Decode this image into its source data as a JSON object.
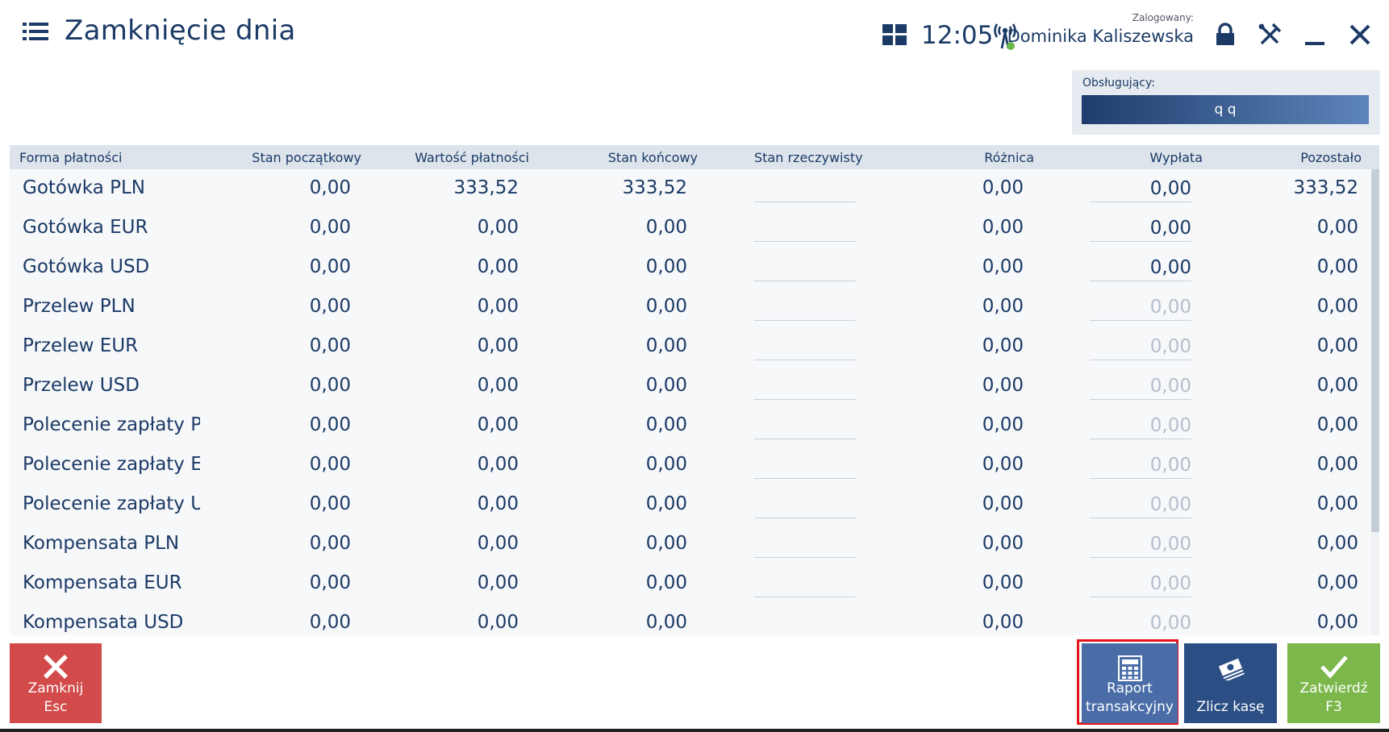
{
  "header": {
    "title": "Zamknięcie dnia",
    "time": "12:05",
    "logged_caption": "Zalogowany:",
    "user_name": "Dominika Kaliszewska",
    "icons": [
      "menu-icon",
      "tiles-icon",
      "antenna-icon",
      "lock-icon",
      "tools-icon",
      "minimize-icon",
      "close-icon"
    ]
  },
  "operator": {
    "label": "Obsługujący:",
    "value": "q q"
  },
  "table": {
    "columns": [
      "Forma płatności",
      "Stan początkowy",
      "Wartość płatności",
      "Stan końcowy",
      "Stan rzeczywisty",
      "Różnica",
      "Wypłata",
      "Pozostało"
    ],
    "rows": [
      {
        "name": "Gotówka PLN",
        "start": "0,00",
        "payment": "333,52",
        "end": "333,52",
        "diff": "0,00",
        "payout": "0,00",
        "payout_enabled": true,
        "left": "333,52"
      },
      {
        "name": "Gotówka EUR",
        "start": "0,00",
        "payment": "0,00",
        "end": "0,00",
        "diff": "0,00",
        "payout": "0,00",
        "payout_enabled": true,
        "left": "0,00"
      },
      {
        "name": "Gotówka USD",
        "start": "0,00",
        "payment": "0,00",
        "end": "0,00",
        "diff": "0,00",
        "payout": "0,00",
        "payout_enabled": true,
        "left": "0,00"
      },
      {
        "name": "Przelew PLN",
        "start": "0,00",
        "payment": "0,00",
        "end": "0,00",
        "diff": "0,00",
        "payout": "0,00",
        "payout_enabled": false,
        "left": "0,00"
      },
      {
        "name": "Przelew EUR",
        "start": "0,00",
        "payment": "0,00",
        "end": "0,00",
        "diff": "0,00",
        "payout": "0,00",
        "payout_enabled": false,
        "left": "0,00"
      },
      {
        "name": "Przelew USD",
        "start": "0,00",
        "payment": "0,00",
        "end": "0,00",
        "diff": "0,00",
        "payout": "0,00",
        "payout_enabled": false,
        "left": "0,00"
      },
      {
        "name": "Polecenie zapłaty PLN",
        "start": "0,00",
        "payment": "0,00",
        "end": "0,00",
        "diff": "0,00",
        "payout": "0,00",
        "payout_enabled": false,
        "left": "0,00"
      },
      {
        "name": "Polecenie zapłaty EUR",
        "start": "0,00",
        "payment": "0,00",
        "end": "0,00",
        "diff": "0,00",
        "payout": "0,00",
        "payout_enabled": false,
        "left": "0,00"
      },
      {
        "name": "Polecenie zapłaty USD",
        "start": "0,00",
        "payment": "0,00",
        "end": "0,00",
        "diff": "0,00",
        "payout": "0,00",
        "payout_enabled": false,
        "left": "0,00"
      },
      {
        "name": "Kompensata PLN",
        "start": "0,00",
        "payment": "0,00",
        "end": "0,00",
        "diff": "0,00",
        "payout": "0,00",
        "payout_enabled": false,
        "left": "0,00"
      },
      {
        "name": "Kompensata EUR",
        "start": "0,00",
        "payment": "0,00",
        "end": "0,00",
        "diff": "0,00",
        "payout": "0,00",
        "payout_enabled": false,
        "left": "0,00"
      },
      {
        "name": "Kompensata USD",
        "start": "0,00",
        "payment": "0,00",
        "end": "0,00",
        "diff": "0,00",
        "payout": "0,00",
        "payout_enabled": false,
        "left": "0,00"
      }
    ]
  },
  "buttons": {
    "close": {
      "line1": "Zamknij",
      "line2": "Esc",
      "icon": "x-icon"
    },
    "report": {
      "line1": "Raport",
      "line2": "transakcyjny",
      "icon": "calculator-icon"
    },
    "count": {
      "line1": "Zlicz kasę",
      "icon": "cash-icon"
    },
    "confirm": {
      "line1": "Zatwierdź",
      "line2": "F3",
      "icon": "checkmark-icon"
    }
  },
  "colors": {
    "primary": "#1b3a66",
    "close_button": "#d24a4a",
    "report_button": "#4a6da8",
    "count_button": "#2b4e85",
    "confirm_button": "#7bb74a",
    "highlight": "#e0141a"
  }
}
